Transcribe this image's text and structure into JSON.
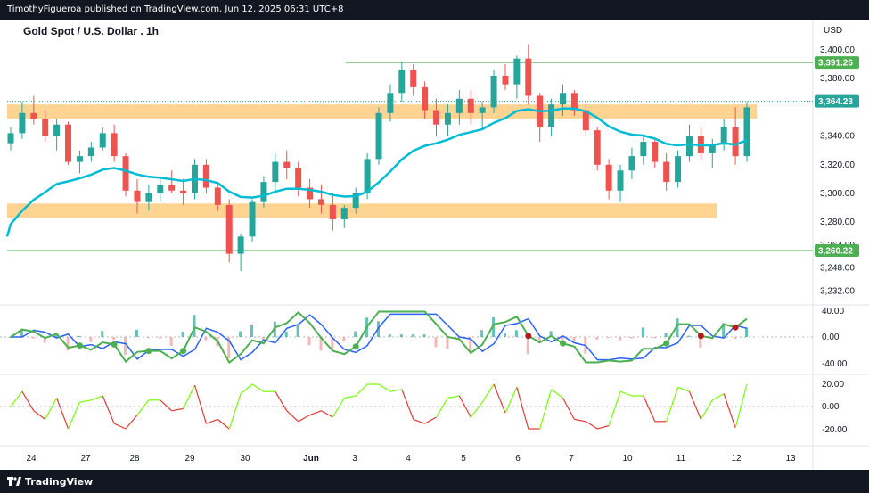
{
  "header": {
    "published": "TimothyFigueroa published on TradingView.com, Jun 12, 2025 06:31 UTC+8"
  },
  "footer": {
    "brand": "TradingView",
    "logo_icon": "tradingview-logo-icon"
  },
  "chart": {
    "title": "Gold Spot / U.S. Dollar . 1h",
    "currency": "USD",
    "colors": {
      "up": "#26a69a",
      "down": "#ef5350",
      "ma": "#00bcd4",
      "zone": "#ffcc80",
      "hline": "#4caf50",
      "osc_green": "#4caf50",
      "osc_dark": "#b71c1c",
      "osc_blue": "#2962ff",
      "rsi_up": "#76ff03",
      "rsi_down": "#e53935"
    }
  },
  "chart_data": {
    "type": "candlestick",
    "title": "Gold Spot / U.S. Dollar . 1h",
    "price_axis": {
      "ticks": [
        "3,400.00",
        "3,380.00",
        "3,340.00",
        "3,320.00",
        "3,300.00",
        "3,280.00",
        "3,264.00",
        "3,248.00",
        "3,232.00"
      ],
      "labels": [
        {
          "text": "3,391.26",
          "kind": "line-level"
        },
        {
          "text": "3,364.23",
          "kind": "last-price"
        },
        {
          "text": "3,260.22",
          "kind": "line-level"
        }
      ],
      "ylim": [
        3232,
        3410
      ]
    },
    "osc_axis": {
      "ticks": [
        "40.00",
        "0.00",
        "-40.00"
      ]
    },
    "rsi_axis": {
      "ticks": [
        "20.00",
        "0.00",
        "-20.00"
      ]
    },
    "x_labels": [
      "24",
      "27",
      "28",
      "29",
      "30",
      "Jun",
      "3",
      "4",
      "5",
      "6",
      "7",
      "10",
      "11",
      "12",
      "13"
    ],
    "horizontal_lines": [
      3391.26,
      3260.22
    ],
    "zones": [
      {
        "from": 3352,
        "to": 3362,
        "span": "full"
      },
      {
        "from": 3283,
        "to": 3293,
        "span": "to-day-12"
      }
    ],
    "candles": [
      [
        3335,
        3346,
        3330,
        3342
      ],
      [
        3342,
        3364,
        3338,
        3356
      ],
      [
        3356,
        3368,
        3348,
        3352
      ],
      [
        3352,
        3358,
        3336,
        3340
      ],
      [
        3340,
        3352,
        3330,
        3348
      ],
      [
        3348,
        3350,
        3320,
        3322
      ],
      [
        3322,
        3330,
        3314,
        3326
      ],
      [
        3326,
        3336,
        3322,
        3332
      ],
      [
        3332,
        3346,
        3330,
        3342
      ],
      [
        3342,
        3348,
        3322,
        3326
      ],
      [
        3326,
        3328,
        3298,
        3302
      ],
      [
        3302,
        3310,
        3286,
        3294
      ],
      [
        3294,
        3306,
        3288,
        3300
      ],
      [
        3300,
        3312,
        3294,
        3306
      ],
      [
        3306,
        3316,
        3300,
        3302
      ],
      [
        3302,
        3310,
        3292,
        3300
      ],
      [
        3300,
        3324,
        3296,
        3320
      ],
      [
        3320,
        3324,
        3300,
        3304
      ],
      [
        3304,
        3306,
        3288,
        3292
      ],
      [
        3292,
        3296,
        3252,
        3258
      ],
      [
        3258,
        3272,
        3246,
        3270
      ],
      [
        3270,
        3296,
        3266,
        3294
      ],
      [
        3294,
        3312,
        3290,
        3308
      ],
      [
        3308,
        3328,
        3302,
        3322
      ],
      [
        3322,
        3330,
        3310,
        3318
      ],
      [
        3318,
        3322,
        3298,
        3304
      ],
      [
        3304,
        3310,
        3290,
        3296
      ],
      [
        3296,
        3306,
        3286,
        3292
      ],
      [
        3292,
        3300,
        3274,
        3282
      ],
      [
        3282,
        3292,
        3276,
        3290
      ],
      [
        3290,
        3304,
        3286,
        3300
      ],
      [
        3300,
        3328,
        3296,
        3324
      ],
      [
        3324,
        3360,
        3320,
        3356
      ],
      [
        3356,
        3376,
        3350,
        3370
      ],
      [
        3370,
        3392,
        3364,
        3386
      ],
      [
        3386,
        3390,
        3368,
        3374
      ],
      [
        3374,
        3378,
        3352,
        3358
      ],
      [
        3358,
        3366,
        3340,
        3348
      ],
      [
        3348,
        3362,
        3340,
        3356
      ],
      [
        3356,
        3372,
        3348,
        3366
      ],
      [
        3366,
        3372,
        3348,
        3356
      ],
      [
        3356,
        3364,
        3344,
        3360
      ],
      [
        3360,
        3386,
        3356,
        3382
      ],
      [
        3382,
        3390,
        3372,
        3376
      ],
      [
        3376,
        3396,
        3366,
        3394
      ],
      [
        3394,
        3404,
        3362,
        3368
      ],
      [
        3368,
        3370,
        3336,
        3346
      ],
      [
        3346,
        3366,
        3340,
        3362
      ],
      [
        3362,
        3376,
        3354,
        3370
      ],
      [
        3370,
        3372,
        3354,
        3358
      ],
      [
        3358,
        3364,
        3340,
        3344
      ],
      [
        3344,
        3346,
        3316,
        3320
      ],
      [
        3320,
        3324,
        3296,
        3302
      ],
      [
        3302,
        3320,
        3294,
        3316
      ],
      [
        3316,
        3332,
        3310,
        3326
      ],
      [
        3326,
        3340,
        3320,
        3336
      ],
      [
        3336,
        3338,
        3318,
        3322
      ],
      [
        3322,
        3328,
        3302,
        3308
      ],
      [
        3308,
        3330,
        3304,
        3326
      ],
      [
        3326,
        3348,
        3322,
        3340
      ],
      [
        3340,
        3346,
        3324,
        3328
      ],
      [
        3328,
        3338,
        3318,
        3334
      ],
      [
        3334,
        3352,
        3330,
        3346
      ],
      [
        3346,
        3360,
        3320,
        3326
      ],
      [
        3326,
        3364,
        3322,
        3360
      ]
    ]
  }
}
